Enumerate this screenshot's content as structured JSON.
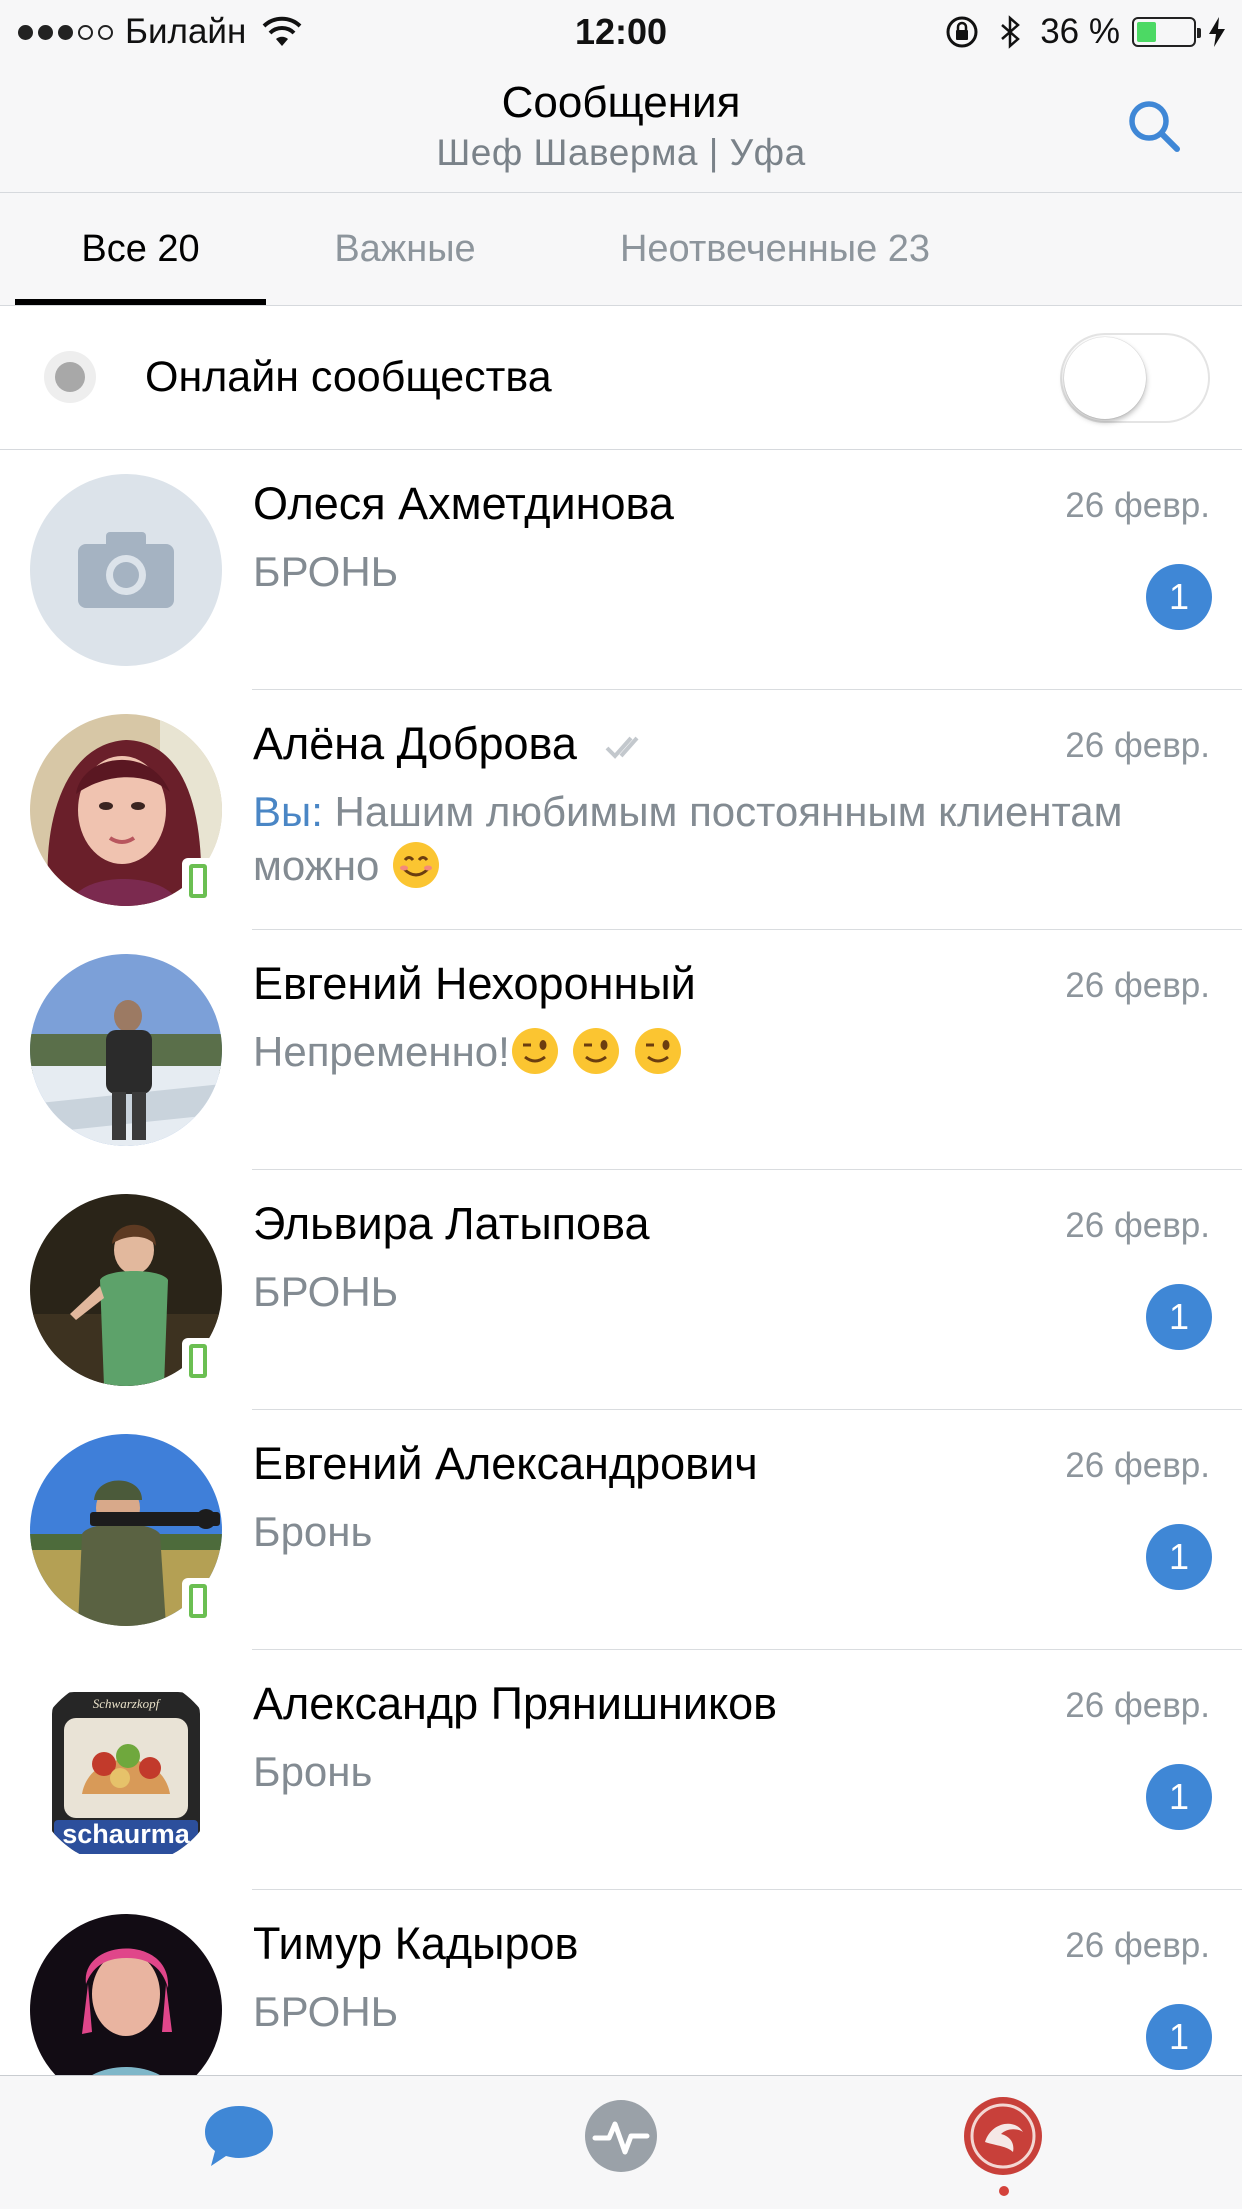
{
  "status_bar": {
    "carrier": "Билайн",
    "time": "12:00",
    "battery_percent": "36 %",
    "battery_level": 0.36,
    "battery_color": "#4cd964"
  },
  "nav": {
    "title": "Сообщения",
    "subtitle": "Шеф Шаверма | Уфа",
    "search_icon": "search-icon",
    "accent_color": "#3f87d6"
  },
  "tabs": [
    {
      "label": "Все 20",
      "active": true
    },
    {
      "label": "Важные",
      "active": false
    },
    {
      "label": "Неотвеченные 23",
      "active": false
    }
  ],
  "online_filter": {
    "label": "Онлайн сообщества",
    "enabled": false
  },
  "conversations": [
    {
      "name": "Олеся Ахметдинова",
      "date": "26 февр.",
      "preview": "БРОНЬ",
      "unread": "1",
      "mobile": false,
      "avatar": "camera-placeholder"
    },
    {
      "name": "Алёна Доброва",
      "date": "26 февр.",
      "you_prefix": "Вы:",
      "preview": "Нашим любимым постоянным клиентам можно",
      "read_mark": true,
      "emoji": "smiling-emoji",
      "mobile": true,
      "avatar": "photo"
    },
    {
      "name": "Евгений Нехоронный",
      "date": "26 февр.",
      "preview": "Непременно!",
      "emoji": "winking-emoji",
      "emoji_count": 3,
      "mobile": false,
      "avatar": "photo"
    },
    {
      "name": "Эльвира Латыпова",
      "date": "26 февр.",
      "preview": "БРОНЬ",
      "unread": "1",
      "mobile": true,
      "avatar": "photo"
    },
    {
      "name": "Евгений Александрович",
      "date": "26 февр.",
      "preview": "Бронь",
      "unread": "1",
      "mobile": true,
      "avatar": "photo"
    },
    {
      "name": "Александр Прянишников",
      "date": "26 февр.",
      "preview": "Бронь",
      "unread": "1",
      "mobile": false,
      "avatar": "logo",
      "logo_text": "schaurma",
      "logo_top_text": "Schwarzkopf"
    },
    {
      "name": "Тимур Кадыров",
      "date": "26 февр.",
      "preview": "БРОНЬ",
      "unread": "1",
      "mobile": false,
      "avatar": "photo"
    }
  ],
  "tab_bar": [
    {
      "icon": "chat-bubble-icon",
      "active": true
    },
    {
      "icon": "activity-pulse-icon",
      "active": false
    },
    {
      "icon": "community-avatar-icon",
      "active": false,
      "notification_dot": true
    }
  ]
}
